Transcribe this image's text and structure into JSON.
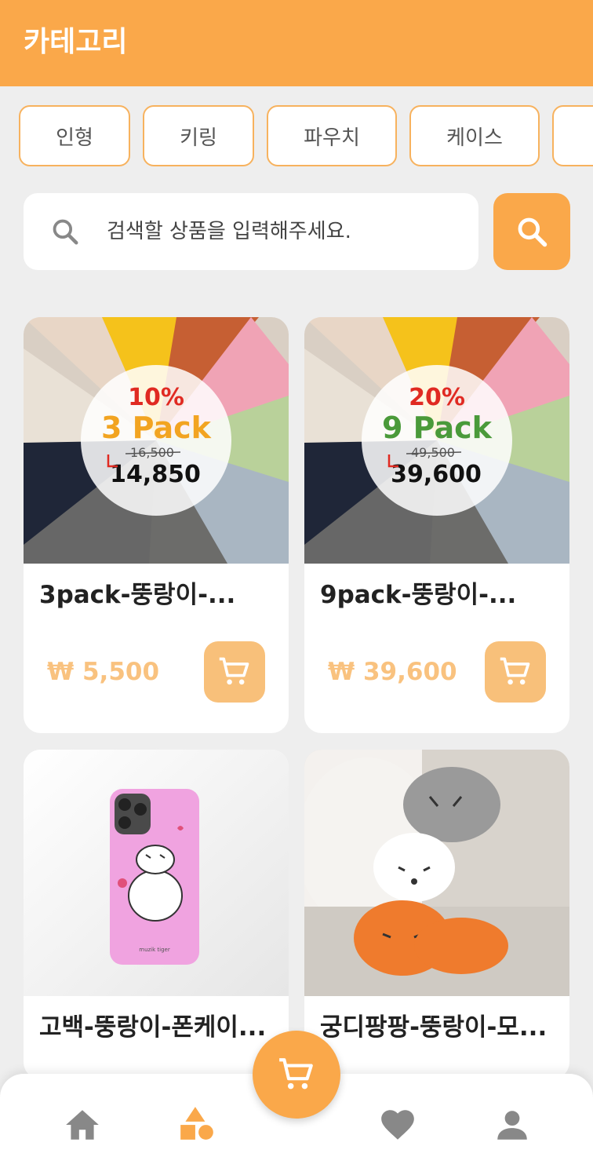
{
  "header": {
    "title": "카테고리"
  },
  "categories": [
    "인형",
    "키링",
    "파우치",
    "케이스"
  ],
  "search": {
    "placeholder": "검색할 상품을 입력해주세요."
  },
  "products": [
    {
      "name": "3pack-뚱랑이-...",
      "price": "₩ 5,500",
      "badge": {
        "percent": "10%",
        "pack": "3 Pack",
        "old_price": "16,500",
        "new_price": "14,850"
      }
    },
    {
      "name": "9pack-뚱랑이-...",
      "price": "₩ 39,600",
      "badge": {
        "percent": "20%",
        "pack": "9 Pack",
        "old_price": "49,500",
        "new_price": "39,600"
      }
    },
    {
      "name": "고백-뚱랑이-폰케이...",
      "case_brand": "muzik tiger"
    },
    {
      "name": "궁디팡팡-뚱랑이-모..."
    }
  ],
  "colors": {
    "accent": "#faa84a",
    "accent_light": "#f8c07a",
    "price": "#f9c27f",
    "background": "#eeeeee"
  },
  "icons": {
    "search": "search-icon",
    "cart": "cart-icon",
    "home": "home-icon",
    "categories": "shapes-icon",
    "favorites": "heart-icon",
    "profile": "person-icon"
  }
}
